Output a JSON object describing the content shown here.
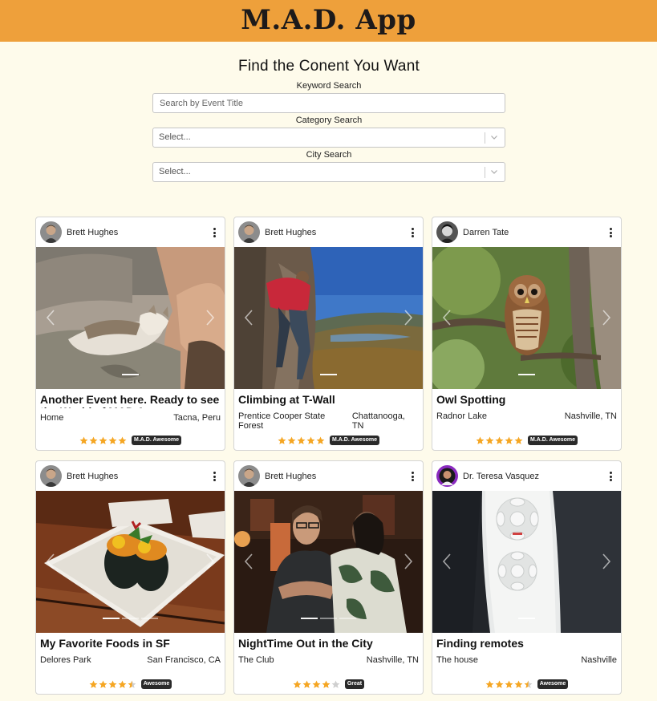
{
  "header": {
    "title": "M.A.D. App"
  },
  "search": {
    "heading": "Find the Conent You Want",
    "keyword_label": "Keyword Search",
    "keyword_placeholder": "Search by Event Title",
    "category_label": "Category Search",
    "category_value": "Select...",
    "city_label": "City Search",
    "city_value": "Select..."
  },
  "colors": {
    "header": "#eea03b",
    "background": "#fefbeb",
    "star": "#f5a623",
    "star_empty": "#cfcfcf",
    "badge": "#2a2a2a"
  },
  "cards": [
    {
      "author": "Brett Hughes",
      "title": "Another Event here. Ready to see the World of MAD App",
      "venue": "Home",
      "city": "Tacna, Peru",
      "rating": 5,
      "badge": "M.A.D. Awesome",
      "image": "cat-sleeping-on-man-photo"
    },
    {
      "author": "Brett Hughes",
      "title": "Climbing at T-Wall",
      "venue": "Prentice Cooper State Forest",
      "city": "Chattanooga, TN",
      "rating": 5,
      "badge": "M.A.D. Awesome",
      "image": "rock-climber-photo"
    },
    {
      "author": "Darren Tate",
      "title": "Owl Spotting",
      "venue": "Radnor Lake",
      "city": "Nashville, TN",
      "rating": 5,
      "badge": "M.A.D. Awesome",
      "image": "barred-owl-photo"
    },
    {
      "author": "Brett Hughes",
      "title": "My Favorite Foods in SF",
      "venue": "Delores Park",
      "city": "San Francisco, CA",
      "rating": 4.5,
      "badge": "Awesome",
      "image": "sushi-plate-photo"
    },
    {
      "author": "Brett Hughes",
      "title": "NightTime Out in the City",
      "venue": "The Club",
      "city": "Nashville, TN",
      "rating": 4,
      "badge": "Great",
      "image": "night-club-photo"
    },
    {
      "author": "Dr. Teresa Vasquez",
      "title": "Finding remotes",
      "venue": "The house",
      "city": "Nashville",
      "rating": 4.5,
      "badge": "Awesome",
      "image": "remote-control-photo"
    }
  ]
}
